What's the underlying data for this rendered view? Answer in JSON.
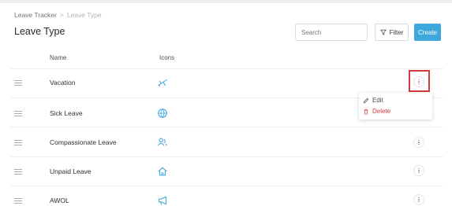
{
  "breadcrumb": {
    "root": "Leave Tracker",
    "separator": ">",
    "current": "Leave Type"
  },
  "page_title": "Leave Type",
  "toolbar": {
    "search_placeholder": "Search",
    "filter_label": "Filter",
    "create_label": "Create"
  },
  "table": {
    "headers": {
      "name": "Name",
      "icons": "Icons"
    },
    "rows": [
      {
        "name": "Vacation",
        "icon": "airplane-icon"
      },
      {
        "name": "Sick Leave",
        "icon": "globe-icon"
      },
      {
        "name": "Compassionate Leave",
        "icon": "people-icon"
      },
      {
        "name": "Unpaid Leave",
        "icon": "house-icon"
      },
      {
        "name": "AWOL",
        "icon": "megaphone-icon"
      }
    ]
  },
  "context_menu": {
    "edit_label": "Edit",
    "delete_label": "Delete"
  },
  "colors": {
    "accent": "#3ea7db",
    "icon": "#3ea7db",
    "danger": "#d43b3b",
    "highlight": "#d03a3a"
  }
}
